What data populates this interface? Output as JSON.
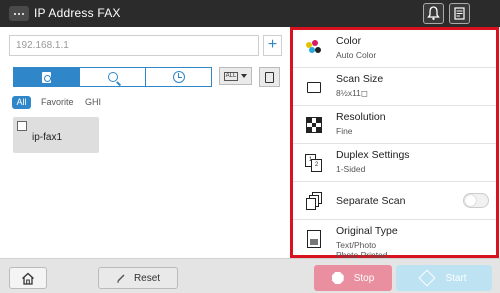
{
  "window": {
    "title": "IP Address FAX"
  },
  "address": {
    "value": "192.168.1.1",
    "add_label": "+"
  },
  "view_dropdown": {
    "label": "ALL"
  },
  "filters": {
    "all": "All",
    "favorite": "Favorite",
    "ghi": "GHI"
  },
  "destinations": [
    {
      "name": "ip-fax1"
    }
  ],
  "settings": [
    {
      "label": "Color",
      "value": "Auto Color"
    },
    {
      "label": "Scan Size",
      "value": "8½x11◻"
    },
    {
      "label": "Resolution",
      "value": "Fine"
    },
    {
      "label": "Duplex Settings",
      "value": "1-Sided"
    },
    {
      "label": "Separate Scan",
      "value": ""
    },
    {
      "label": "Original Type",
      "value": "Text/Photo",
      "value2": "Photo Printed"
    }
  ],
  "bottom": {
    "reset": "Reset",
    "stop": "Stop",
    "start": "Start"
  },
  "colors": {
    "accent": "#2f86c8",
    "highlight_border": "#d9121f",
    "stop": "#ea8fa0",
    "start": "#bde3f3"
  }
}
